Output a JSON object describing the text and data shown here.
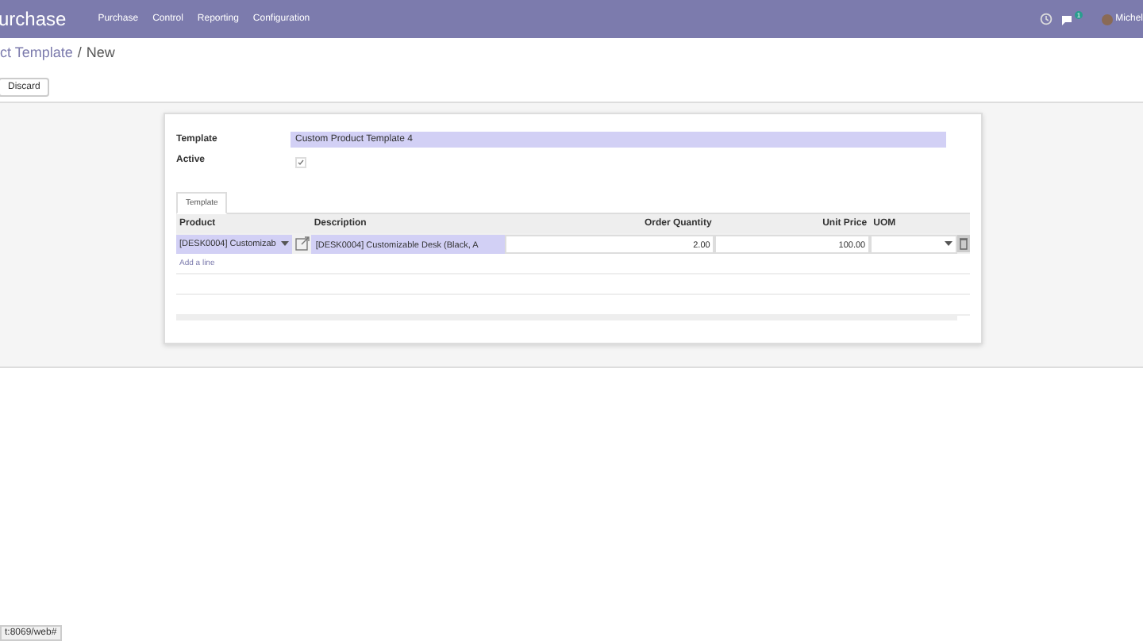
{
  "navbar": {
    "app_name": "urchase",
    "menu": [
      "Purchase",
      "Control",
      "Reporting",
      "Configuration"
    ],
    "message_count": "1",
    "user": "Michel"
  },
  "breadcrumb": {
    "parent": "ct Template",
    "separator": "/",
    "current": "New"
  },
  "buttons": [
    "Discard"
  ],
  "form": {
    "template_label": "Template",
    "template_value": "Custom Product Template 4",
    "active_label": "Active",
    "active_checked": true
  },
  "tabs": [
    {
      "label": "Template",
      "selected": true
    }
  ],
  "table": {
    "columns": [
      "Product",
      "Description",
      "Order Quantity",
      "Unit Price",
      "UOM"
    ],
    "rows": [
      {
        "product": "[DESK0004] Customizab",
        "description": "[DESK0004] Customizable Desk (Black, A",
        "quantity": "2.00",
        "unit_price": "100.00",
        "uom": ""
      }
    ],
    "add_line": "Add a line"
  },
  "status_bar": "t:8069/web#"
}
